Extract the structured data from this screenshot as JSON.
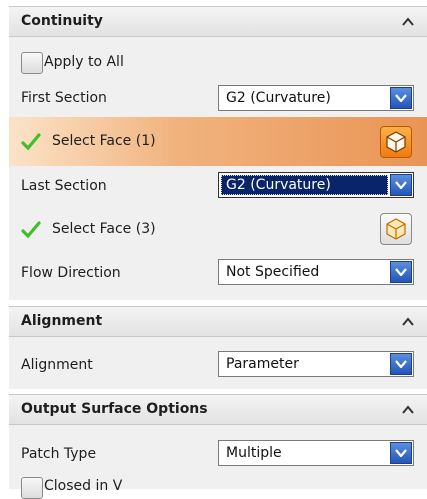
{
  "continuity": {
    "header": "Continuity",
    "apply_to_all": "Apply to All",
    "first_section": {
      "label": "First Section",
      "value": "G2 (Curvature)"
    },
    "select_face_1": "Select Face (1)",
    "last_section": {
      "label": "Last Section",
      "value": "G2 (Curvature)"
    },
    "select_face_3": "Select Face (3)",
    "flow_direction": {
      "label": "Flow Direction",
      "value": "Not Specified"
    }
  },
  "alignment": {
    "header": "Alignment",
    "label": "Alignment",
    "value": "Parameter"
  },
  "output": {
    "header": "Output Surface Options",
    "patch_type": {
      "label": "Patch Type",
      "value": "Multiple"
    },
    "closed_in_v": "Closed in V"
  },
  "colors": {
    "highlight_start": "#fbe3c8",
    "highlight_end": "#e99455",
    "dropdown_arrow": "#2456b8",
    "check_green": "#3fbf2a",
    "selected_combo": "#0a246a"
  }
}
